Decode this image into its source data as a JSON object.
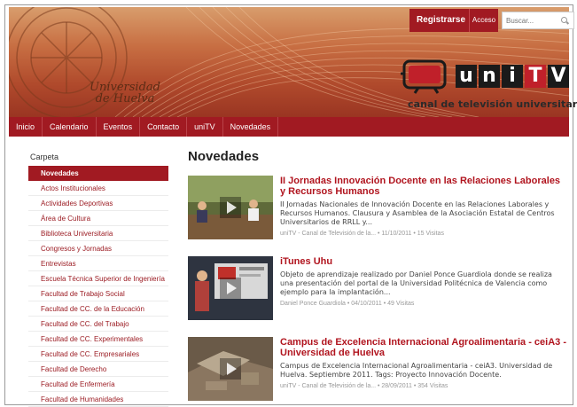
{
  "header": {
    "register_label": "Registrarse",
    "access_label": "Acceso",
    "search_placeholder": "Buscar...",
    "university_name_line1": "Universidad",
    "university_name_line2": "de Huelva",
    "logo_letters": [
      "u",
      "n",
      "i",
      "T",
      "V"
    ],
    "logo_subtitle": "canal de televisión universitaria"
  },
  "nav": {
    "items": [
      "Inicio",
      "Calendario",
      "Eventos",
      "Contacto",
      "uniTV",
      "Novedades"
    ]
  },
  "sidebar": {
    "title": "Carpeta",
    "items": [
      "Novedades",
      "Actos Institucionales",
      "Actividades Deportivas",
      "Área de Cultura",
      "Biblioteca Universitaria",
      "Congresos y Jornadas",
      "Entrevistas",
      "Escuela Técnica Superior de Ingeniería",
      "Facultad de Trabajo Social",
      "Facultad de CC. de la Educación",
      "Facultad de CC. del Trabajo",
      "Facultad de CC. Experimentales",
      "Facultad de CC. Empresariales",
      "Facultad de Derecho",
      "Facultad de Enfermería",
      "Facultad de Humanidades"
    ]
  },
  "main": {
    "title": "Novedades",
    "posts": [
      {
        "title": "II Jornadas Innovación Docente en las Relaciones Laborales y Recursos Humanos",
        "description": "II Jornadas Nacionales de Innovación Docente en las Relaciones Laborales y Recursos Humanos. Clausura y Asamblea de la Asociación Estatal de Centros Universitarios de RRLL y...",
        "meta": "uniTV - Canal de Televisión de la...  •  11/10/2011  •  15 Visitas"
      },
      {
        "title": "iTunes Uhu",
        "description": "Objeto de aprendizaje realizado por Daniel Ponce Guardiola donde se realiza una presentación del portal de la Universidad Politécnica de Valencia como ejemplo para la implantación...",
        "meta": "Daniel Ponce Guardiola  •  04/10/2011  •  49 Visitas"
      },
      {
        "title": "Campus de Excelencia Internacional Agroalimentaria - ceiA3 - Universidad de Huelva",
        "description": "Campus de Excelencia Internacional Agroalimentaria - ceiA3. Universidad de Huelva. Septiembre 2011. Tags: Proyecto Innovación Docente.",
        "meta": "uniTV - Canal de Televisión de la...  •  28/09/2011  •  354 Visitas"
      }
    ]
  },
  "colors": {
    "brand_red": "#a11a22",
    "link_red": "#b1151f"
  }
}
